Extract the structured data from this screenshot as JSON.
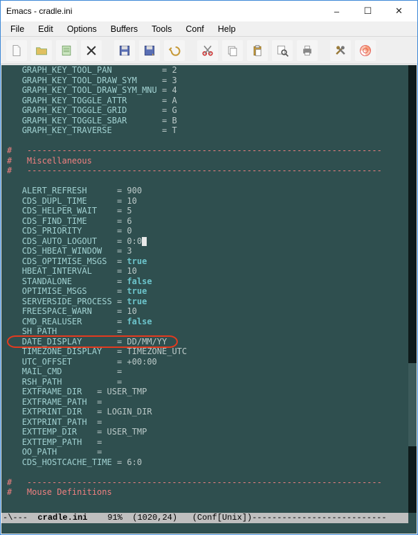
{
  "window": {
    "title": "Emacs - cradle.ini",
    "min_label": "–",
    "max_label": "☐",
    "close_label": "✕"
  },
  "menu": {
    "items": [
      "File",
      "Edit",
      "Options",
      "Buffers",
      "Tools",
      "Conf",
      "Help"
    ]
  },
  "toolbar_icons": [
    "new-file-icon",
    "open-file-icon",
    "dired-icon",
    "kill-buffer-icon",
    "save-icon",
    "save-as-icon",
    "undo-icon",
    "cut-icon",
    "copy-icon",
    "paste-icon",
    "search-icon",
    "print-icon",
    "prefs-icon",
    "help-icon"
  ],
  "config": {
    "graph_keys": [
      {
        "name": "GRAPH_KEY_TOOL_PAN",
        "value": "2"
      },
      {
        "name": "GRAPH_KEY_TOOL_DRAW_SYM",
        "value": "3"
      },
      {
        "name": "GRAPH_KEY_TOOL_DRAW_SYM_MNU",
        "value": "4"
      },
      {
        "name": "GRAPH_KEY_TOGGLE_ATTR",
        "value": "A"
      },
      {
        "name": "GRAPH_KEY_TOGGLE_GRID",
        "value": "G"
      },
      {
        "name": "GRAPH_KEY_TOGGLE_SBAR",
        "value": "B"
      },
      {
        "name": "GRAPH_KEY_TRAVERSE",
        "value": "T"
      }
    ],
    "section_misc_title": "Miscellaneous",
    "dash_line": "-----------------------------------------------------------------------",
    "misc": [
      {
        "name": "ALERT_REFRESH",
        "value": "900",
        "col": 22
      },
      {
        "name": "CDS_DUPL_TIME",
        "value": "10",
        "col": 22
      },
      {
        "name": "CDS_HELPER_WAIT",
        "value": "5",
        "col": 22
      },
      {
        "name": "CDS_FIND_TIME",
        "value": "6",
        "col": 22
      },
      {
        "name": "CDS_PRIORITY",
        "value": "0",
        "col": 22
      },
      {
        "name": "CDS_AUTO_LOGOUT",
        "value": "0:0",
        "col": 22,
        "cursor_after": true
      },
      {
        "name": "CDS_HBEAT_WINDOW",
        "value": "3",
        "col": 22
      },
      {
        "name": "CDS_OPTIMISE_MSGS",
        "value": "true",
        "col": 22,
        "kw": true
      },
      {
        "name": "HBEAT_INTERVAL",
        "value": "10",
        "col": 22
      },
      {
        "name": "STANDALONE",
        "value": "false",
        "col": 22,
        "kw": true
      },
      {
        "name": "OPTIMISE_MSGS",
        "value": "true",
        "col": 22,
        "kw": true
      },
      {
        "name": "SERVERSIDE_PROCESS",
        "value": "true",
        "col": 22,
        "kw": true
      },
      {
        "name": "FREESPACE_WARN",
        "value": "10",
        "col": 22
      },
      {
        "name": "CMD_REALUSER",
        "value": "false",
        "col": 22,
        "kw": true
      },
      {
        "name": "SH_PATH",
        "value": "",
        "col": 22
      },
      {
        "name": "DATE_DISPLAY",
        "value": "DD/MM/YY",
        "col": 22,
        "highlight": true
      },
      {
        "name": "TIMEZONE_DISPLAY",
        "value": "TIMEZONE_UTC",
        "col": 22
      },
      {
        "name": "UTC_OFFSET",
        "value": "+00:00",
        "col": 22
      },
      {
        "name": "MAIL_CMD",
        "value": "",
        "col": 22
      },
      {
        "name": "RSH_PATH",
        "value": "",
        "col": 22
      },
      {
        "name": "EXTFRAME_DIR",
        "value": "USER_TMP",
        "col": 18
      },
      {
        "name": "EXTFRAME_PATH",
        "value": "",
        "col": 18
      },
      {
        "name": "EXTPRINT_DIR",
        "value": "LOGIN_DIR",
        "col": 18
      },
      {
        "name": "EXTPRINT_PATH",
        "value": "",
        "col": 18
      },
      {
        "name": "EXTTEMP_DIR",
        "value": "USER_TMP",
        "col": 18
      },
      {
        "name": "EXTTEMP_PATH",
        "value": "",
        "col": 18
      },
      {
        "name": "OO_PATH",
        "value": "",
        "col": 18
      },
      {
        "name": "CDS_HOSTCACHE_TIME",
        "value": "6:0",
        "col": 22
      }
    ],
    "section_mouse_title": "Mouse Definitions"
  },
  "modeline": {
    "left": "-\\---  ",
    "filename": "cradle.ini",
    "percent": "91%",
    "pos": "(1020,24)",
    "mode": "(Conf[Unix])",
    "trail": "---------------------------"
  }
}
